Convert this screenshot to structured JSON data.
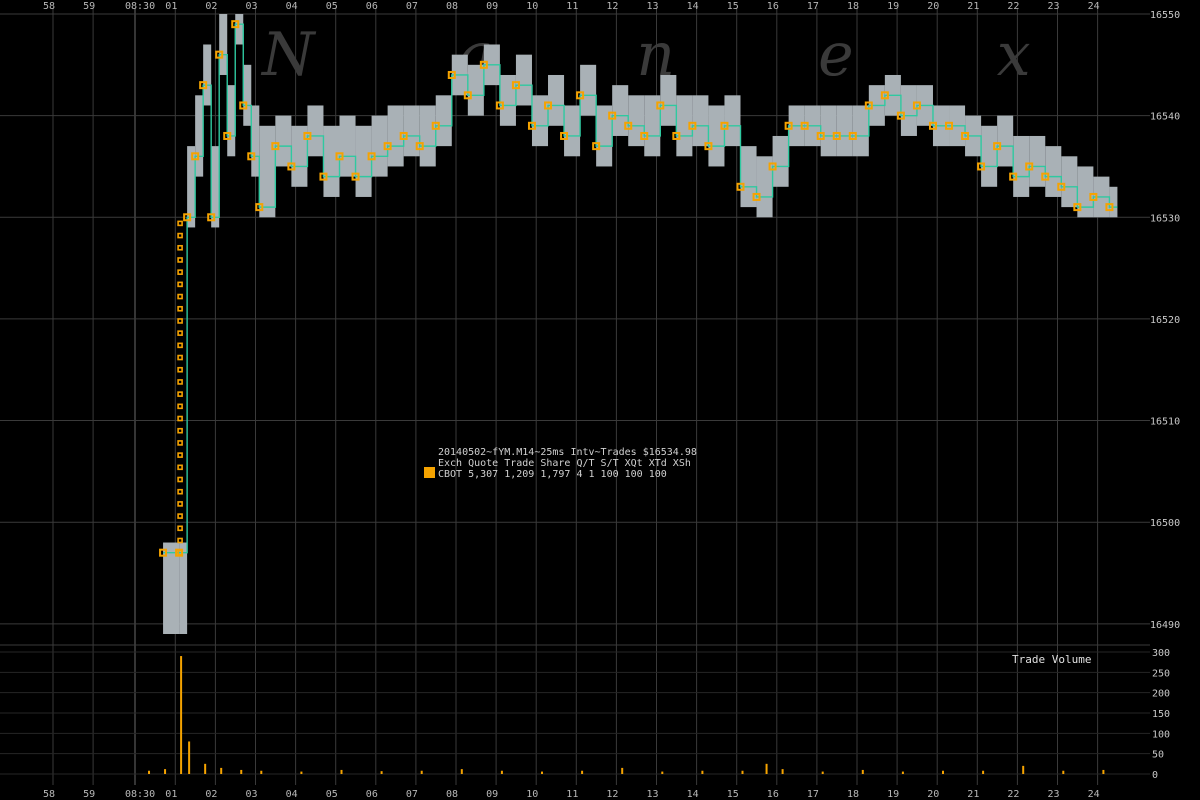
{
  "chart_data": {
    "type": "line",
    "title": "20140502~fYM.M14~25ms Intv~Trades $16534.98",
    "watermark": "N a n e x",
    "x_ticks": [
      "58",
      "59",
      "08:30",
      "01",
      "02",
      "03",
      "04",
      "05",
      "06",
      "07",
      "08",
      "09",
      "10",
      "11",
      "12",
      "13",
      "14",
      "15",
      "16",
      "17",
      "18",
      "19",
      "20",
      "21",
      "22",
      "23",
      "24"
    ],
    "price_axis": {
      "ticks": [
        16490,
        16500,
        16510,
        16520,
        16530,
        16540,
        16550
      ],
      "ylim": [
        16489,
        16550
      ]
    },
    "volume_axis": {
      "label": "Trade Volume",
      "ticks": [
        0,
        50,
        100,
        150,
        200,
        250,
        300
      ],
      "ylim": [
        0,
        300
      ]
    },
    "legend": {
      "header": "Exch Quote Trade Share  Q/T   S/T  XQt XTd XSh",
      "row": "CBOT 5,307 1,209 1,797     4     1 100 100 100",
      "swatch_color": "#f5a300"
    },
    "colors": {
      "trade": "#f5a300",
      "bid_ask_spread": "#a9b1b6",
      "midpoint_line": "#2fc9a0",
      "volume": "#f5a300",
      "grid": "#3a3a3a"
    },
    "series": [
      {
        "name": "CBOT",
        "x_seconds": [
          0.6,
          1.0,
          1.2,
          1.4,
          1.6,
          1.8,
          2.0,
          2.2,
          2.4,
          2.6,
          2.8,
          3.0,
          3.4,
          3.8,
          4.2,
          4.6,
          5.0,
          5.4,
          5.8,
          6.2,
          6.6,
          7.0,
          7.4,
          7.8,
          8.2,
          8.6,
          9.0,
          9.4,
          9.8,
          10.2,
          10.6,
          11.0,
          11.4,
          11.8,
          12.2,
          12.6,
          13.0,
          13.4,
          13.8,
          14.2,
          14.6,
          15.0,
          15.4,
          15.8,
          16.2,
          16.6,
          17.0,
          17.4,
          17.8,
          18.2,
          18.6,
          19.0,
          19.4,
          19.8,
          20.2,
          20.6,
          21.0,
          21.4,
          21.8,
          22.2,
          22.6,
          23.0,
          23.4,
          23.8,
          24.2
        ],
        "price": [
          16497,
          16497,
          16530,
          16536,
          16543,
          16530,
          16546,
          16538,
          16549,
          16541,
          16536,
          16531,
          16537,
          16535,
          16538,
          16534,
          16536,
          16534,
          16536,
          16537,
          16538,
          16537,
          16539,
          16544,
          16542,
          16545,
          16541,
          16543,
          16539,
          16541,
          16538,
          16542,
          16537,
          16540,
          16539,
          16538,
          16541,
          16538,
          16539,
          16537,
          16539,
          16533,
          16532,
          16535,
          16539,
          16539,
          16538,
          16538,
          16538,
          16541,
          16542,
          16540,
          16541,
          16539,
          16539,
          16538,
          16535,
          16537,
          16534,
          16535,
          16534,
          16533,
          16531,
          16532,
          16531
        ],
        "spread_low": [
          16489,
          16489,
          16529,
          16534,
          16541,
          16529,
          16544,
          16536,
          16547,
          16539,
          16534,
          16530,
          16535,
          16533,
          16536,
          16532,
          16534,
          16532,
          16534,
          16535,
          16536,
          16535,
          16537,
          16542,
          16540,
          16543,
          16539,
          16541,
          16537,
          16539,
          16536,
          16540,
          16535,
          16538,
          16537,
          16536,
          16539,
          16536,
          16537,
          16535,
          16537,
          16531,
          16530,
          16533,
          16537,
          16537,
          16536,
          16536,
          16536,
          16539,
          16540,
          16538,
          16539,
          16537,
          16537,
          16536,
          16533,
          16535,
          16532,
          16533,
          16532,
          16531,
          16530,
          16530,
          16530
        ],
        "spread_high": [
          16498,
          16498,
          16537,
          16542,
          16547,
          16537,
          16550,
          16543,
          16550,
          16545,
          16541,
          16539,
          16540,
          16539,
          16541,
          16539,
          16540,
          16539,
          16540,
          16541,
          16541,
          16541,
          16542,
          16546,
          16545,
          16547,
          16544,
          16546,
          16542,
          16544,
          16541,
          16545,
          16541,
          16543,
          16542,
          16542,
          16544,
          16542,
          16542,
          16541,
          16542,
          16537,
          16536,
          16538,
          16541,
          16541,
          16541,
          16541,
          16541,
          16543,
          16544,
          16543,
          16543,
          16541,
          16541,
          16540,
          16539,
          16540,
          16538,
          16538,
          16537,
          16536,
          16535,
          16534,
          16533
        ]
      }
    ],
    "volume": {
      "x_seconds": [
        0.2,
        0.6,
        1.0,
        1.2,
        1.6,
        2.0,
        2.5,
        3.0,
        4.0,
        5.0,
        6.0,
        7.0,
        8.0,
        9.0,
        10.0,
        11.0,
        12.0,
        13.0,
        14.0,
        15.0,
        15.6,
        16.0,
        17.0,
        18.0,
        19.0,
        20.0,
        21.0,
        22.0,
        23.0,
        24.0
      ],
      "values": [
        8,
        12,
        290,
        80,
        25,
        15,
        10,
        8,
        6,
        10,
        7,
        8,
        12,
        8,
        6,
        8,
        15,
        6,
        8,
        8,
        25,
        12,
        6,
        10,
        6,
        8,
        8,
        20,
        8,
        10
      ]
    }
  }
}
